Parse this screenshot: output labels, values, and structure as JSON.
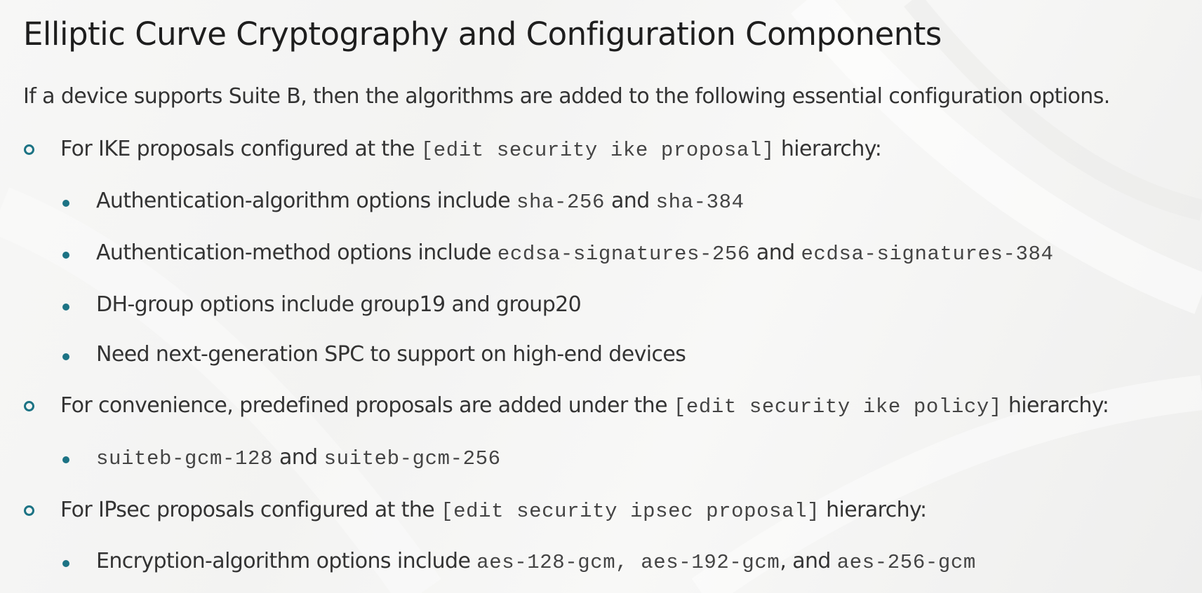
{
  "title": "Elliptic Curve Cryptography and Configuration Components",
  "intro": "If a device supports Suite B, then the algorithms are added to the following essential configuration options.",
  "items": [
    {
      "prefix": "For IKE proposals configured at the ",
      "code": "[edit security ike proposal]",
      "suffix": " hierarchy:",
      "subitems": [
        {
          "text1": "Authentication-algorithm options include ",
          "code1": "sha-256",
          "text2": " and ",
          "code2": "sha-384"
        },
        {
          "text1": "Authentication-method options include ",
          "code1": "ecdsa-signatures-256",
          "text2": " and ",
          "code2": "ecdsa-signatures-384"
        },
        {
          "text1": "DH-group options include group19 and group20"
        },
        {
          "text1": "Need next-generation SPC to support on high-end devices"
        }
      ]
    },
    {
      "prefix": "For convenience, predefined proposals are added under the ",
      "code": "[edit security ike policy]",
      "suffix": " hierarchy:",
      "subitems": [
        {
          "code1": "suiteb-gcm-128",
          "text2": " and ",
          "code2": "suiteb-gcm-256"
        }
      ]
    },
    {
      "prefix": "For IPsec proposals configured at the ",
      "code": "[edit security ipsec proposal]",
      "suffix": " hierarchy:",
      "subitems": [
        {
          "text1": "Encryption-algorithm options include ",
          "code1": "aes-128-gcm, aes-192-gcm",
          "text2": ", and ",
          "code2": "aes-256-gcm"
        }
      ]
    }
  ],
  "colors": {
    "bullet": "#1c7384",
    "text": "#333333",
    "title": "#1e1e1e"
  },
  "icons": {
    "level1_bullet": "hollow-circle-bullet-icon",
    "level2_bullet": "filled-dot-bullet-icon"
  }
}
